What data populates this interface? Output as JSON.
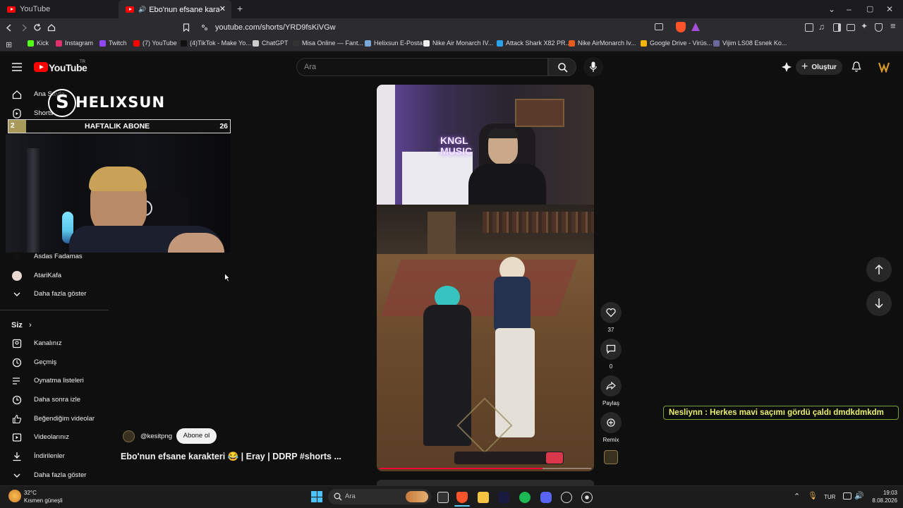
{
  "browser": {
    "tabs": [
      {
        "label": "YouTube"
      },
      {
        "label": "Ebo'nun efsane karakteri 😂"
      }
    ],
    "url": "youtube.com/shorts/YRD9fsKiVGw",
    "bookmarks": [
      {
        "label": "Kick",
        "color": "#53fc18"
      },
      {
        "label": "Instagram",
        "color": "#e1306c"
      },
      {
        "label": "Twitch",
        "color": "#9146ff"
      },
      {
        "label": "(7) YouTube",
        "color": "#ff0000"
      },
      {
        "label": "(4)TikTok - Make Yo...",
        "color": "#111111"
      },
      {
        "label": "ChatGPT",
        "color": "#cccccc"
      },
      {
        "label": "Misa Online — Fant...",
        "color": "#333333"
      },
      {
        "label": "Helixsun E-Posta",
        "color": "#7aa7d8"
      },
      {
        "label": "Nike Air Monarch IV...",
        "color": "#eeeeee"
      },
      {
        "label": "Attack Shark X82 PR...",
        "color": "#2aa3e8"
      },
      {
        "label": "Nike AirMonarch Iv...",
        "color": "#e85a1e"
      },
      {
        "label": "Google Drive - Virüs...",
        "color": "#f4b400"
      },
      {
        "label": "Vijim LS08 Esnek Ko...",
        "color": "#6a6a9a"
      }
    ]
  },
  "youtube": {
    "logo_text": "YouTube",
    "logo_region": "TR",
    "search_placeholder": "Ara",
    "create_label": "Oluştur"
  },
  "sidebar": {
    "top_items": [
      {
        "label": "Ana Sayfa",
        "icon": "home-icon"
      },
      {
        "label": "Shorts",
        "icon": "shorts-icon"
      }
    ],
    "subscriptions": [
      {
        "label": "Asdas Fadamas"
      },
      {
        "label": "AtariKafa"
      }
    ],
    "show_more": "Daha fazla göster",
    "you_section": "Siz",
    "you_items": [
      {
        "label": "Kanalınız",
        "icon": "channel-icon"
      },
      {
        "label": "Geçmiş",
        "icon": "history-icon"
      },
      {
        "label": "Oynatma listeleri",
        "icon": "playlist-icon"
      },
      {
        "label": "Daha sonra izle",
        "icon": "watch-later-icon"
      },
      {
        "label": "Beğendiğim videolar",
        "icon": "liked-icon"
      },
      {
        "label": "Videolarınız",
        "icon": "your-videos-icon"
      },
      {
        "label": "İndirilenler",
        "icon": "download-icon"
      }
    ],
    "show_more_2": "Daha fazla göster"
  },
  "overlay": {
    "brand": "HELIXSUN",
    "abone_rank": "2",
    "abone_label": "HAFTALIK ABONE",
    "abone_count": "26"
  },
  "short": {
    "channel": "@kesitpng",
    "subscribe_label": "Abone ol",
    "title": "Ebo'nun efsane karakteri 😂 | Eray | DDRP #shorts ...",
    "neon_sign": "KNGL MUSIC",
    "likes": "37",
    "comments": "0",
    "share_label": "Paylaş",
    "remix_label": "Remix",
    "progress": 0.77
  },
  "chat": {
    "message": "Nesliynn : Herkes mavi saçımı gördü çaldı dmdkdmkdm"
  },
  "taskbar": {
    "temperature": "32°C",
    "weather": "Kısmen güneşli",
    "search_placeholder": "Ara",
    "language": "TUR",
    "time": "19:03",
    "date": "8.08.2026"
  }
}
